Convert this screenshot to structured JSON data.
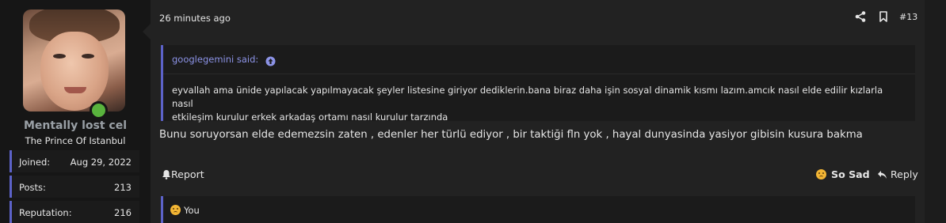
{
  "user": {
    "name": "Mentally lost cel",
    "title": "The Prince Of Istanbul",
    "stats": [
      {
        "label": "Joined:",
        "value": "Aug 29, 2022"
      },
      {
        "label": "Posts:",
        "value": "213"
      },
      {
        "label": "Reputation:",
        "value": "216"
      }
    ]
  },
  "post": {
    "time": "26 minutes ago",
    "number": "#13",
    "quote": {
      "author": "googlegemini said:",
      "line1": "eyvallah ama ünide yapılacak yapılmayacak şeyler listesine giriyor dediklerin.bana biraz daha işin sosyal dinamik kısmı lazım.amcık nasıl elde edilir kızlarla nasıl",
      "line2": "etkileşim kurulur erkek arkadaş ortamı nasıl kurulur tarzında"
    },
    "message": "Bunu soruyorsan elde edemezsin zaten , edenler her türlü ediyor , bir taktiği fln yok , hayal dunyasinda yasiyor gibisin kusura bakma"
  },
  "actions": {
    "report": "Report",
    "reaction": "So Sad",
    "reply": "Reply"
  },
  "reactions_summary": {
    "text": "You"
  },
  "icons": {
    "share": "share-icon",
    "bookmark": "bookmark-icon",
    "report": "bell-icon",
    "reply": "reply-arrow-icon",
    "quote_up": "arrow-up-circle-icon",
    "sad": "sad-face-emoji"
  },
  "colors": {
    "accent": "#5c62c8",
    "online": "#59b33d",
    "link": "#8c93e6"
  }
}
